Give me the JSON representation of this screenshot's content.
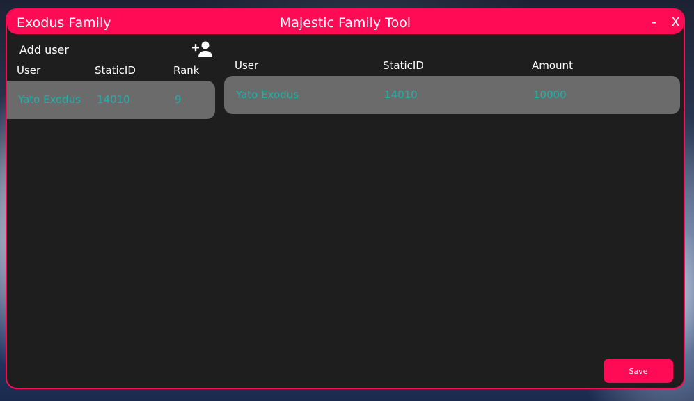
{
  "window": {
    "app_name": "Exodus Family",
    "title": "Majestic Family Tool",
    "minimize_label": "-",
    "close_label": "X"
  },
  "members_panel": {
    "add_user_label": "Add user",
    "add_user_icon": "person-add-icon",
    "columns": [
      "User",
      "StaticID",
      "Rank"
    ],
    "rows": [
      {
        "user": "Yato Exodus",
        "static_id": "14010",
        "rank": "9"
      }
    ]
  },
  "amounts_panel": {
    "columns": [
      "User",
      "StaticID",
      "Amount"
    ],
    "rows": [
      {
        "user": "Yato Exodus",
        "static_id": "14010",
        "amount": "10000"
      }
    ]
  },
  "footer": {
    "save_label": "Save"
  },
  "colors": {
    "accent": "#ff0a55",
    "window_bg": "#1e1e1e",
    "row_bg": "#6b6b6b",
    "row_text": "#20b2aa",
    "header_text": "#ffffff"
  }
}
